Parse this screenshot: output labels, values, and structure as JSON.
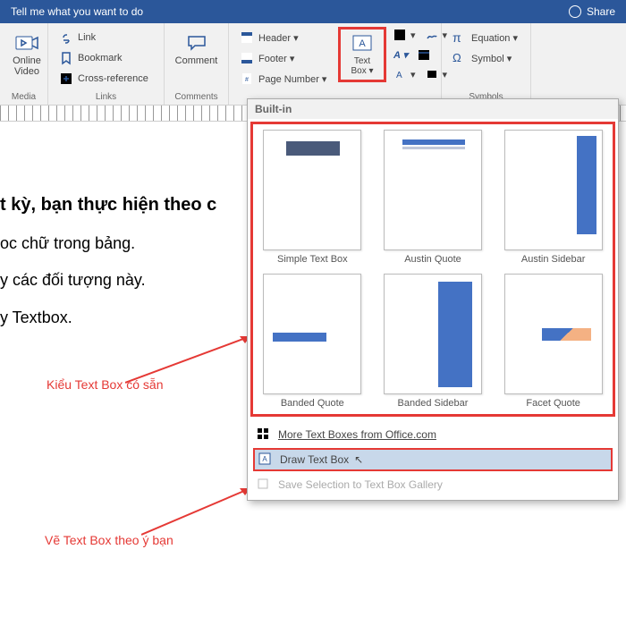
{
  "titlebar": {
    "tell_me": "Tell me what you want to do",
    "share": "Share"
  },
  "ribbon": {
    "media": {
      "label": "Media",
      "online_video": "Online\nVideo"
    },
    "links": {
      "label": "Links",
      "link": "Link",
      "bookmark": "Bookmark",
      "crossref": "Cross-reference"
    },
    "comments": {
      "label": "Comments",
      "comment": "Comment"
    },
    "hf": {
      "header": "Header ▾",
      "footer": "Footer ▾",
      "page_num": "Page Number ▾"
    },
    "textbox": {
      "label": "Text\nBox ▾"
    },
    "symbols": {
      "label": "Symbols",
      "equation": "Equation ▾",
      "symbol": "Symbol ▾"
    }
  },
  "doc_lines": {
    "l1": "t kỳ, bạn thực hiện theo c",
    "l2": "oc chữ trong bảng.",
    "l3": "y các đối tượng này.",
    "l4": "y Textbox."
  },
  "popup": {
    "section": "Built-in",
    "items": [
      "Simple Text Box",
      "Austin Quote",
      "Austin Sidebar",
      "Banded Quote",
      "Banded Sidebar",
      "Facet Quote"
    ],
    "more": "More Text Boxes from Office.com",
    "draw": "Draw Text Box",
    "save": "Save Selection to Text Box Gallery"
  },
  "annotations": {
    "a1": "Kiểu Text Box có sẵn",
    "a2": "Vẽ Text Box theo ý bạn"
  },
  "chart_data": null
}
